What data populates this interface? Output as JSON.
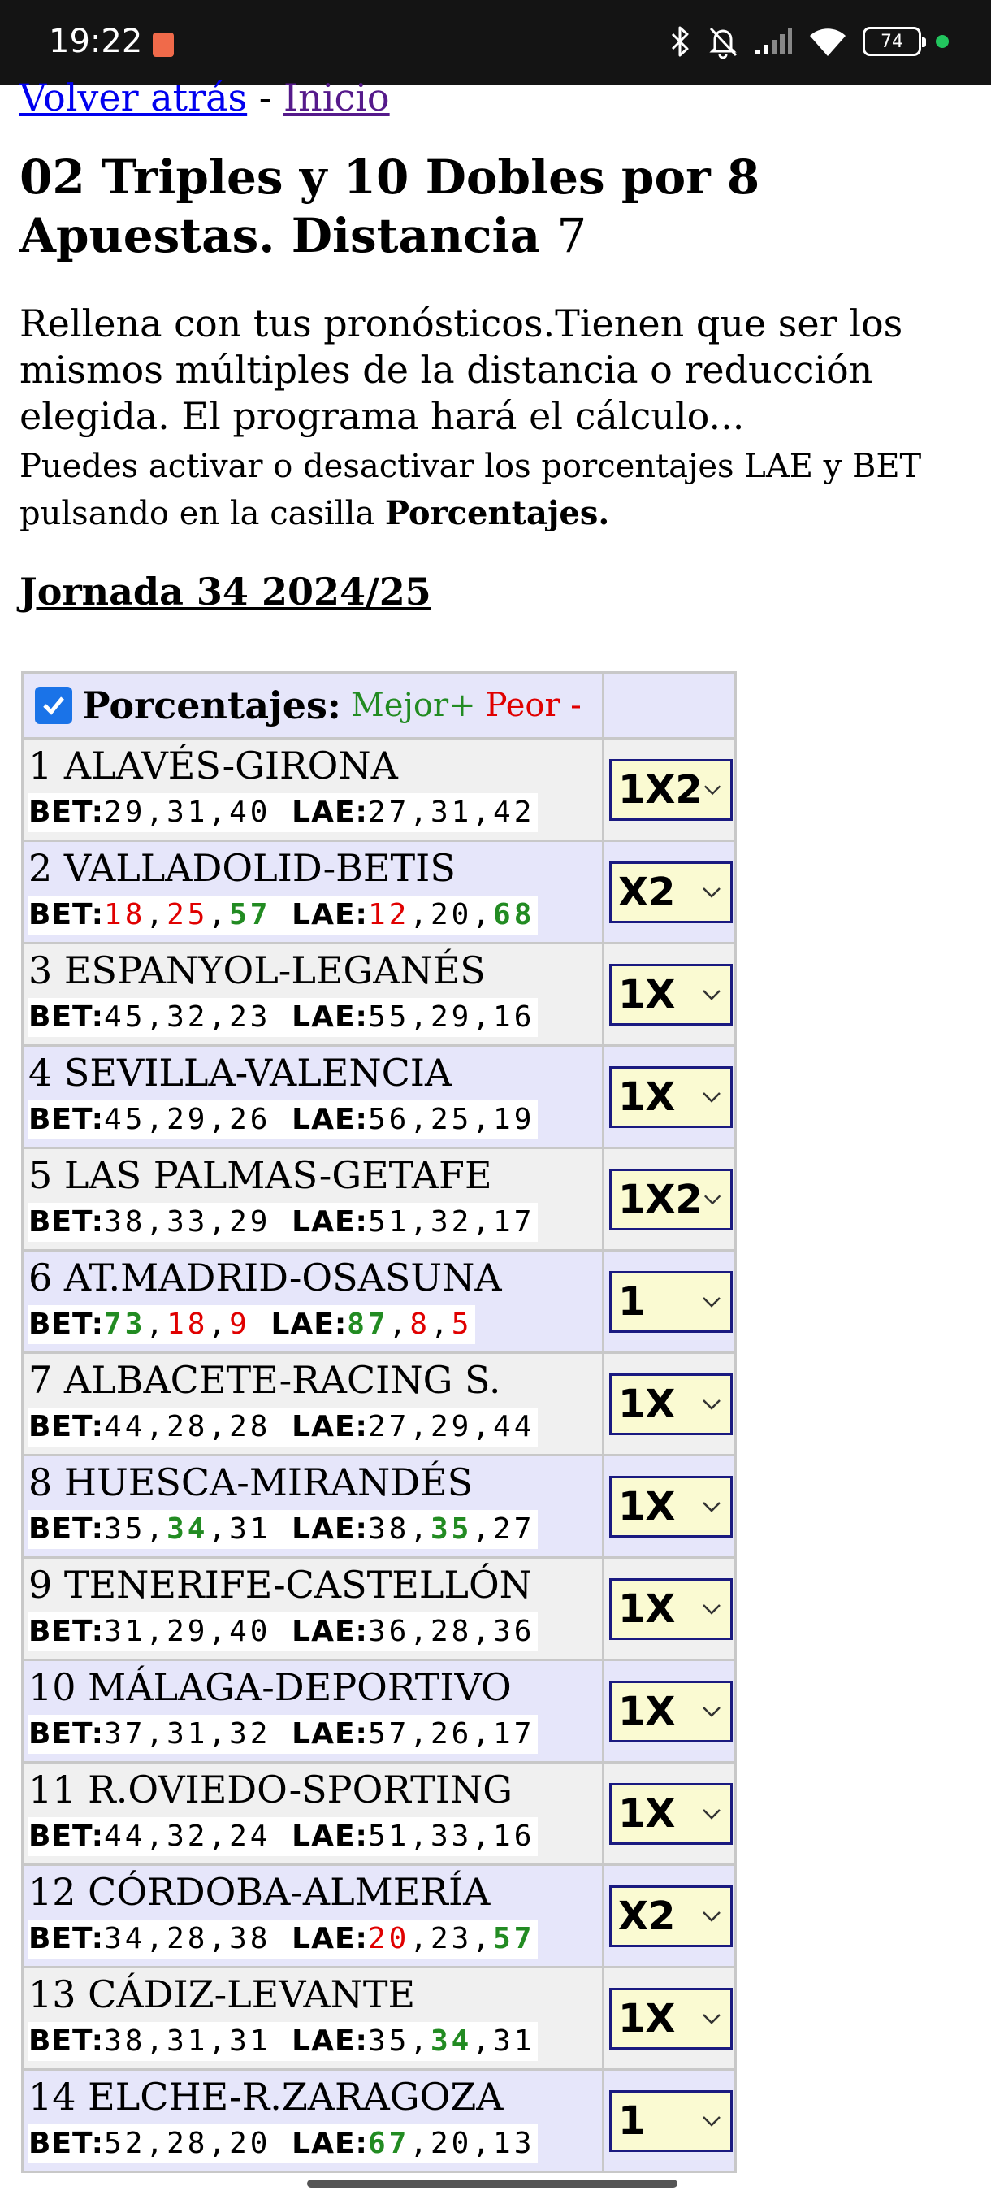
{
  "status": {
    "time": "19:22",
    "battery": "74"
  },
  "nav": {
    "back": "Volver atrás",
    "sep": " - ",
    "home": "Inicio"
  },
  "title": {
    "bold": "02 Triples y 10 Dobles por 8 Apuestas. Distancia ",
    "num": "7"
  },
  "description": "Rellena con tus pronósticos.Tienen que ser los mismos múltiples de la distancia o reducción elegida. El programa hará el cálculo...",
  "note": {
    "text": "Puedes activar o desactivar los porcentajes LAE y BET pulsando en la casilla ",
    "bold": "Porcentajes."
  },
  "jornada": "Jornada 34 2024/25",
  "table": {
    "header": "Porcentajes:",
    "better": "Mejor+",
    "worse": "Peor -",
    "bet_label": "BET:",
    "lae_label": "LAE:",
    "matches": [
      {
        "name": "1 ALAVÉS-GIRONA",
        "bet": [
          [
            "29",
            ""
          ],
          [
            "31",
            ""
          ],
          [
            "40",
            ""
          ]
        ],
        "lae": [
          [
            "27",
            ""
          ],
          [
            "31",
            ""
          ],
          [
            "42",
            ""
          ]
        ],
        "pick": "1X2"
      },
      {
        "name": "2 VALLADOLID-BETIS",
        "bet": [
          [
            "18",
            "r"
          ],
          [
            "25",
            "r"
          ],
          [
            "57",
            "g"
          ]
        ],
        "lae": [
          [
            "12",
            "r"
          ],
          [
            "20",
            ""
          ],
          [
            "68",
            "g"
          ]
        ],
        "pick": "X2"
      },
      {
        "name": "3 ESPANYOL-LEGANÉS",
        "bet": [
          [
            "45",
            ""
          ],
          [
            "32",
            ""
          ],
          [
            "23",
            ""
          ]
        ],
        "lae": [
          [
            "55",
            ""
          ],
          [
            "29",
            ""
          ],
          [
            "16",
            ""
          ]
        ],
        "pick": "1X"
      },
      {
        "name": "4 SEVILLA-VALENCIA",
        "bet": [
          [
            "45",
            ""
          ],
          [
            "29",
            ""
          ],
          [
            "26",
            ""
          ]
        ],
        "lae": [
          [
            "56",
            ""
          ],
          [
            "25",
            ""
          ],
          [
            "19",
            ""
          ]
        ],
        "pick": "1X"
      },
      {
        "name": "5 LAS PALMAS-GETAFE",
        "bet": [
          [
            "38",
            ""
          ],
          [
            "33",
            ""
          ],
          [
            "29",
            ""
          ]
        ],
        "lae": [
          [
            "51",
            ""
          ],
          [
            "32",
            ""
          ],
          [
            "17",
            ""
          ]
        ],
        "pick": "1X2"
      },
      {
        "name": "6 AT.MADRID-OSASUNA",
        "bet": [
          [
            "73",
            "g"
          ],
          [
            "18",
            "r"
          ],
          [
            "9",
            "r"
          ]
        ],
        "lae": [
          [
            "87",
            "g"
          ],
          [
            "8",
            "r"
          ],
          [
            "5",
            "r"
          ]
        ],
        "pick": "1"
      },
      {
        "name": "7 ALBACETE-RACING S.",
        "bet": [
          [
            "44",
            ""
          ],
          [
            "28",
            ""
          ],
          [
            "28",
            ""
          ]
        ],
        "lae": [
          [
            "27",
            ""
          ],
          [
            "29",
            ""
          ],
          [
            "44",
            ""
          ]
        ],
        "pick": "1X"
      },
      {
        "name": "8 HUESCA-MIRANDÉS",
        "bet": [
          [
            "35",
            ""
          ],
          [
            "34",
            "g"
          ],
          [
            "31",
            ""
          ]
        ],
        "lae": [
          [
            "38",
            ""
          ],
          [
            "35",
            "g"
          ],
          [
            "27",
            ""
          ]
        ],
        "pick": "1X"
      },
      {
        "name": "9 TENERIFE-CASTELLÓN",
        "bet": [
          [
            "31",
            ""
          ],
          [
            "29",
            ""
          ],
          [
            "40",
            ""
          ]
        ],
        "lae": [
          [
            "36",
            ""
          ],
          [
            "28",
            ""
          ],
          [
            "36",
            ""
          ]
        ],
        "pick": "1X"
      },
      {
        "name": "10 MÁLAGA-DEPORTIVO",
        "bet": [
          [
            "37",
            ""
          ],
          [
            "31",
            ""
          ],
          [
            "32",
            ""
          ]
        ],
        "lae": [
          [
            "57",
            ""
          ],
          [
            "26",
            ""
          ],
          [
            "17",
            ""
          ]
        ],
        "pick": "1X"
      },
      {
        "name": "11 R.OVIEDO-SPORTING",
        "bet": [
          [
            "44",
            ""
          ],
          [
            "32",
            ""
          ],
          [
            "24",
            ""
          ]
        ],
        "lae": [
          [
            "51",
            ""
          ],
          [
            "33",
            ""
          ],
          [
            "16",
            ""
          ]
        ],
        "pick": "1X"
      },
      {
        "name": "12 CÓRDOBA-ALMERÍA",
        "bet": [
          [
            "34",
            ""
          ],
          [
            "28",
            ""
          ],
          [
            "38",
            ""
          ]
        ],
        "lae": [
          [
            "20",
            "r"
          ],
          [
            "23",
            ""
          ],
          [
            "57",
            "g"
          ]
        ],
        "pick": "X2"
      },
      {
        "name": "13 CÁDIZ-LEVANTE",
        "bet": [
          [
            "38",
            ""
          ],
          [
            "31",
            ""
          ],
          [
            "31",
            ""
          ]
        ],
        "lae": [
          [
            "35",
            ""
          ],
          [
            "34",
            "g"
          ],
          [
            "31",
            ""
          ]
        ],
        "pick": "1X"
      },
      {
        "name": "14 ELCHE-R.ZARAGOZA",
        "bet": [
          [
            "52",
            ""
          ],
          [
            "28",
            ""
          ],
          [
            "20",
            ""
          ]
        ],
        "lae": [
          [
            "67",
            "g"
          ],
          [
            "20",
            ""
          ],
          [
            "13",
            ""
          ]
        ],
        "pick": "1"
      }
    ]
  }
}
